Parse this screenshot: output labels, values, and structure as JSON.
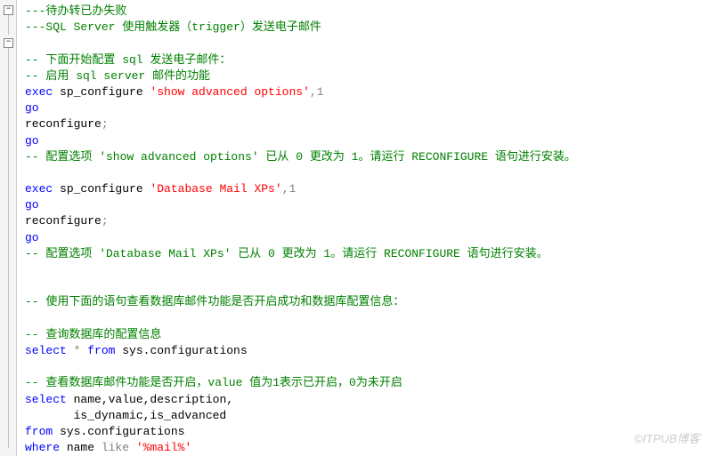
{
  "gutter": {
    "fold1": "−",
    "fold2": "−"
  },
  "lines": {
    "l01": "---待办转已办失败",
    "l02": "---SQL Server 使用触发器（trigger）发送电子邮件",
    "l03": "",
    "l04": "-- 下面开始配置 sql 发送电子邮件：",
    "l05": "-- 启用 sql server 邮件的功能",
    "l06_kw": "exec",
    "l06_id": " sp_configure ",
    "l06_str": "'show advanced options'",
    "l06_rest": ",1",
    "l07": "go",
    "l08_id": "reconfigure",
    "l08_op": ";",
    "l09": "go",
    "l10": "-- 配置选项 'show advanced options' 已从 0 更改为 1。请运行 RECONFIGURE 语句进行安装。",
    "l11": "",
    "l12_kw": "exec",
    "l12_id": " sp_configure ",
    "l12_str": "'Database Mail XPs'",
    "l12_rest": ",1",
    "l13": "go",
    "l14_id": "reconfigure",
    "l14_op": ";",
    "l15": "go",
    "l16": "-- 配置选项 'Database Mail XPs' 已从 0 更改为 1。请运行 RECONFIGURE 语句进行安装。",
    "l17": "",
    "l18": "",
    "l19": "-- 使用下面的语句查看数据库邮件功能是否开启成功和数据库配置信息：",
    "l20": "",
    "l21": "-- 查询数据库的配置信息",
    "l22_kw": "select",
    "l22_star": " * ",
    "l22_from": "from",
    "l22_rest": " sys.configurations",
    "l23": "",
    "l24": "-- 查看数据库邮件功能是否开启，value 值为1表示已开启，0为未开启",
    "l25_kw": "select",
    "l25_ids": " name,value,description,",
    "l26": "       is_dynamic,is_advanced",
    "l27_kw": "from",
    "l27_id": " sys.configurations",
    "l28_kw": "where",
    "l28_id": " name ",
    "l28_like": "like",
    "l28_sp": " ",
    "l28_str": "'%mail%'"
  },
  "watermark": "©ITPUB博客"
}
